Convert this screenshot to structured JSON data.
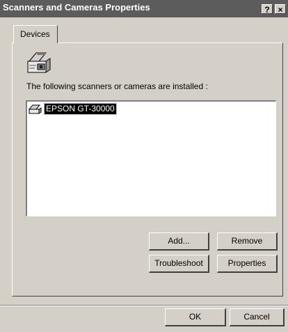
{
  "window": {
    "title": "Scanners and Cameras Properties",
    "help_glyph": "?",
    "close_glyph": "×"
  },
  "tabs": [
    {
      "label": "Devices"
    }
  ],
  "devices_tab": {
    "icon": "scanner-icon",
    "caption": "The following scanners or cameras are installed :",
    "items": [
      {
        "label": "EPSON GT-30000",
        "icon": "scanner-small-icon",
        "selected": true
      }
    ],
    "buttons": {
      "add": "Add...",
      "remove": "Remove",
      "troubleshoot": "Troubleshoot",
      "properties": "Properties"
    }
  },
  "footer": {
    "ok": "OK",
    "cancel": "Cancel"
  }
}
